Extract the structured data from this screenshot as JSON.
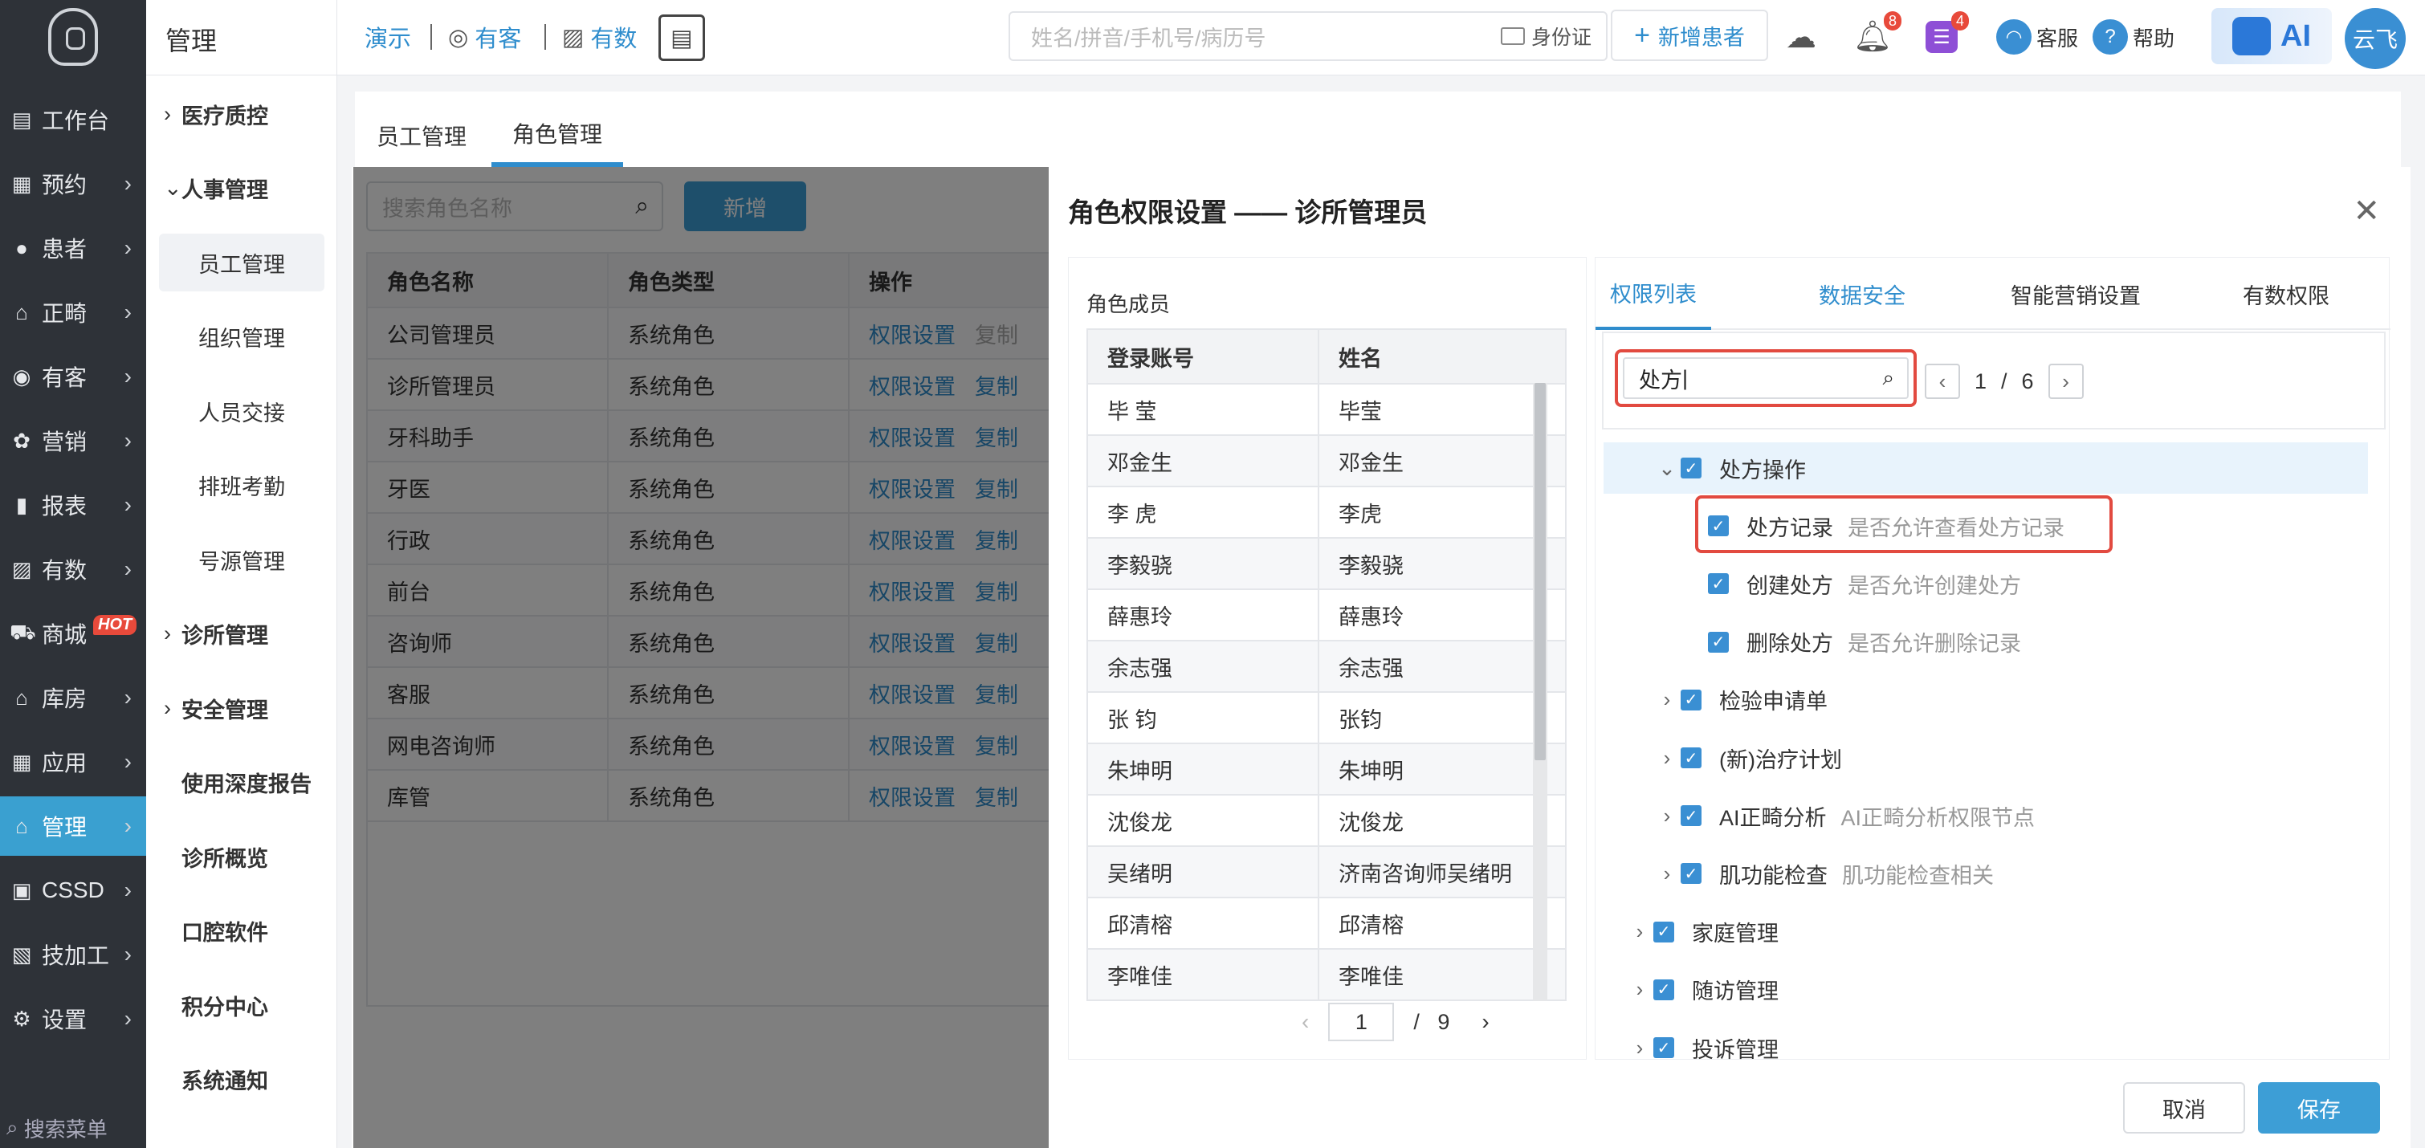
{
  "leftnav": {
    "items": [
      {
        "icon": "workbench-icon",
        "label": "工作台",
        "arrow": false
      },
      {
        "icon": "appointment-icon",
        "label": "预约",
        "arrow": true
      },
      {
        "icon": "patient-icon",
        "label": "患者",
        "arrow": true
      },
      {
        "icon": "orthodontic-icon",
        "label": "正畸",
        "arrow": true
      },
      {
        "icon": "customer-icon",
        "label": "有客",
        "arrow": true
      },
      {
        "icon": "marketing-icon",
        "label": "营销",
        "arrow": true
      },
      {
        "icon": "report-icon",
        "label": "报表",
        "arrow": true
      },
      {
        "icon": "data-icon",
        "label": "有数",
        "arrow": true
      },
      {
        "icon": "cart-icon",
        "label": "商城",
        "arrow": false,
        "badge": "HOT"
      },
      {
        "icon": "warehouse-icon",
        "label": "库房",
        "arrow": true
      },
      {
        "icon": "apps-icon",
        "label": "应用",
        "arrow": true
      },
      {
        "icon": "manage-icon",
        "label": "管理",
        "arrow": true,
        "active": true
      },
      {
        "icon": "cssd-icon",
        "label": "CSSD",
        "arrow": true
      },
      {
        "icon": "lab-icon",
        "label": "技加工",
        "arrow": true
      },
      {
        "icon": "settings-icon",
        "label": "设置",
        "arrow": true
      }
    ],
    "search_label": "搜索菜单"
  },
  "subnav": {
    "title": "管理",
    "items": [
      {
        "label": "医疗质控",
        "type": "group-collapsed"
      },
      {
        "label": "人事管理",
        "type": "group-expanded"
      },
      {
        "label": "员工管理",
        "type": "child",
        "active": true
      },
      {
        "label": "组织管理",
        "type": "child"
      },
      {
        "label": "人员交接",
        "type": "child"
      },
      {
        "label": "排班考勤",
        "type": "child"
      },
      {
        "label": "号源管理",
        "type": "child"
      },
      {
        "label": "诊所管理",
        "type": "group-collapsed"
      },
      {
        "label": "安全管理",
        "type": "group-collapsed"
      },
      {
        "label": "使用深度报告",
        "type": "plain"
      },
      {
        "label": "诊所概览",
        "type": "plain"
      },
      {
        "label": "口腔软件",
        "type": "plain"
      },
      {
        "label": "积分中心",
        "type": "plain"
      },
      {
        "label": "系统通知",
        "type": "plain"
      }
    ]
  },
  "topbar": {
    "demo": "演示",
    "youke": "有客",
    "youshu": "有数",
    "search_placeholder": "姓名/拼音/手机号/病历号",
    "id_card": "身份证",
    "new_patient": "新增患者",
    "notification_count": "8",
    "task_count": "4",
    "service": "客服",
    "help": "帮助",
    "ai": "AI",
    "user": "云飞"
  },
  "main": {
    "tabs": [
      "员工管理",
      "角色管理"
    ],
    "active_tab": 1,
    "role_search_placeholder": "搜索角色名称",
    "new_button": "新增",
    "role_table": {
      "headers": [
        "角色名称",
        "角色类型",
        "操作"
      ],
      "rows": [
        {
          "name": "公司管理员",
          "type": "系统角色",
          "perm": "权限设置",
          "copy": "复制",
          "copy_disabled": true
        },
        {
          "name": "诊所管理员",
          "type": "系统角色",
          "perm": "权限设置",
          "copy": "复制",
          "copy_disabled": false
        },
        {
          "name": "牙科助手",
          "type": "系统角色",
          "perm": "权限设置",
          "copy": "复制",
          "copy_disabled": false
        },
        {
          "name": "牙医",
          "type": "系统角色",
          "perm": "权限设置",
          "copy": "复制",
          "copy_disabled": false
        },
        {
          "name": "行政",
          "type": "系统角色",
          "perm": "权限设置",
          "copy": "复制",
          "copy_disabled": false
        },
        {
          "name": "前台",
          "type": "系统角色",
          "perm": "权限设置",
          "copy": "复制",
          "copy_disabled": false
        },
        {
          "name": "咨询师",
          "type": "系统角色",
          "perm": "权限设置",
          "copy": "复制",
          "copy_disabled": false
        },
        {
          "name": "客服",
          "type": "系统角色",
          "perm": "权限设置",
          "copy": "复制",
          "copy_disabled": false
        },
        {
          "name": "网电咨询师",
          "type": "系统角色",
          "perm": "权限设置",
          "copy": "复制",
          "copy_disabled": false
        },
        {
          "name": "库管",
          "type": "系统角色",
          "perm": "权限设置",
          "copy": "复制",
          "copy_disabled": false
        }
      ]
    }
  },
  "drawer": {
    "title": "角色权限设置 —— 诊所管理员",
    "members_label": "角色成员",
    "members_headers": [
      "登录账号",
      "姓名"
    ],
    "members": [
      {
        "account": "毕 莹",
        "name": "毕莹"
      },
      {
        "account": "邓金生",
        "name": "邓金生"
      },
      {
        "account": "李 虎",
        "name": "李虎"
      },
      {
        "account": "李毅骁",
        "name": "李毅骁"
      },
      {
        "account": "薛惠玲",
        "name": "薛惠玲"
      },
      {
        "account": "余志强",
        "name": "余志强"
      },
      {
        "account": "张 钧",
        "name": "张钧"
      },
      {
        "account": "朱坤明",
        "name": "朱坤明"
      },
      {
        "account": "沈俊龙",
        "name": "沈俊龙"
      },
      {
        "account": "吴绪明",
        "name": "济南咨询师吴绪明"
      },
      {
        "account": "邱清榕",
        "name": "邱清榕"
      },
      {
        "account": "李唯佳",
        "name": "李唯佳"
      }
    ],
    "members_page": "1",
    "members_pages": "9",
    "perm_tabs": [
      "权限列表",
      "数据安全",
      "智能营销设置",
      "有数权限"
    ],
    "perm_search_value": "处方",
    "perm_page": "1",
    "perm_pages": "6",
    "tree": [
      {
        "label": "处方操作",
        "desc": "",
        "level": 1,
        "expand": "v"
      },
      {
        "label": "处方记录",
        "desc": "是否允许查看处方记录",
        "level": 2,
        "expand": ""
      },
      {
        "label": "创建处方",
        "desc": "是否允许创建处方",
        "level": 2,
        "expand": ""
      },
      {
        "label": "删除处方",
        "desc": "是否允许删除记录",
        "level": 2,
        "expand": ""
      },
      {
        "label": "检验申请单",
        "desc": "",
        "level": 1,
        "expand": ">"
      },
      {
        "label": "(新)治疗计划",
        "desc": "",
        "level": 1,
        "expand": ">"
      },
      {
        "label": "AI正畸分析",
        "desc": "AI正畸分析权限节点",
        "level": 1,
        "expand": ">"
      },
      {
        "label": "肌功能检查",
        "desc": "肌功能检查相关",
        "level": 1,
        "expand": ">"
      },
      {
        "label": "家庭管理",
        "desc": "",
        "level": 0,
        "expand": ">"
      },
      {
        "label": "随访管理",
        "desc": "",
        "level": 0,
        "expand": ">"
      },
      {
        "label": "投诉管理",
        "desc": "",
        "level": 0,
        "expand": ">"
      }
    ],
    "cancel": "取消",
    "save": "保存"
  }
}
